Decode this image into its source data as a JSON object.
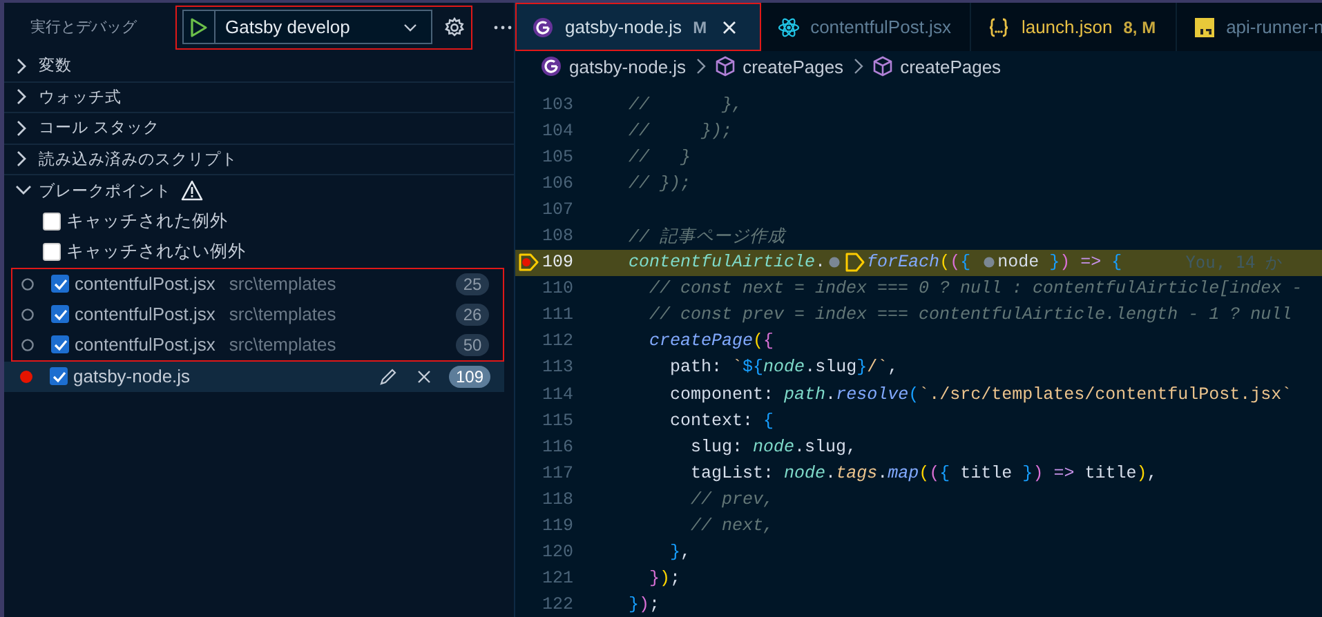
{
  "sidebar": {
    "title": "実行とデバッグ",
    "run_config": {
      "name": "Gatsby develop",
      "highlighted": true
    },
    "sections": [
      {
        "label": "変数",
        "expanded": false,
        "warning": false
      },
      {
        "label": "ウォッチ式",
        "expanded": false,
        "warning": false
      },
      {
        "label": "コール スタック",
        "expanded": false,
        "warning": false
      },
      {
        "label": "読み込み済みのスクリプト",
        "expanded": false,
        "warning": false
      },
      {
        "label": "ブレークポイント",
        "expanded": true,
        "warning": true
      }
    ],
    "exception_filters": [
      {
        "label": "キャッチされた例外",
        "checked": false
      },
      {
        "label": "キャッチされない例外",
        "checked": false
      }
    ],
    "breakpoints": [
      {
        "file": "contentfulPost.jsx",
        "path": "src\\templates",
        "line": "25",
        "checked": true,
        "verified": false,
        "selected": false,
        "highlighted": true
      },
      {
        "file": "contentfulPost.jsx",
        "path": "src\\templates",
        "line": "26",
        "checked": true,
        "verified": false,
        "selected": false,
        "highlighted": true
      },
      {
        "file": "contentfulPost.jsx",
        "path": "src\\templates",
        "line": "50",
        "checked": true,
        "verified": false,
        "selected": false,
        "highlighted": true
      },
      {
        "file": "gatsby-node.js",
        "line": "109",
        "checked": true,
        "verified": true,
        "selected": true,
        "highlighted": false
      }
    ]
  },
  "editor": {
    "tabs": [
      {
        "label": "gatsby-node.js",
        "kind": "gatsby",
        "badge": "M",
        "warning": false,
        "selected": true,
        "highlighted": true
      },
      {
        "label": "contentfulPost.jsx",
        "kind": "react",
        "warning": false,
        "selected": false,
        "highlighted": false
      },
      {
        "label": "launch.json",
        "kind": "json",
        "badge": "8, M",
        "warning": true,
        "selected": false,
        "highlighted": false
      },
      {
        "label": "api-runner-n",
        "kind": "js",
        "warning": false,
        "selected": false,
        "highlighted": false
      }
    ],
    "breadcrumbs": [
      {
        "label": "gatsby-node.js",
        "kind": "gatsby"
      },
      {
        "label": "createPages",
        "kind": "cube"
      },
      {
        "label": "createPages",
        "kind": "cube"
      }
    ],
    "lines": [
      {
        "number": "103",
        "tokens": [
          {
            "kind": "comment",
            "t": "//       },"
          }
        ]
      },
      {
        "number": "104",
        "tokens": [
          {
            "kind": "comment",
            "t": "//     });"
          }
        ]
      },
      {
        "number": "105",
        "tokens": [
          {
            "kind": "comment",
            "t": "//   }"
          }
        ]
      },
      {
        "number": "106",
        "tokens": [
          {
            "kind": "comment",
            "t": "// });"
          }
        ]
      },
      {
        "number": "107"
      },
      {
        "number": "108",
        "tokens": [
          {
            "kind": "comment",
            "t": "// 記事ページ作成"
          }
        ]
      },
      {
        "number": "109",
        "current": true,
        "breakpoint": true,
        "tokens": [
          {
            "kind": "var",
            "t": "contentfulAirticle"
          },
          {
            "kind": "plain",
            "t": "."
          },
          {
            "kind": "inline-bp"
          },
          {
            "kind": "inline-bp-current"
          },
          {
            "kind": "func",
            "t": "forEach"
          },
          {
            "kind": "gold",
            "t": "("
          },
          {
            "kind": "orchid",
            "t": "("
          },
          {
            "kind": "blue",
            "t": "{ "
          },
          {
            "kind": "inline-bp"
          },
          {
            "kind": "plain",
            "t": "node "
          },
          {
            "kind": "blue",
            "t": "}"
          },
          {
            "kind": "orchid",
            "t": ")"
          },
          {
            "kind": "keyword",
            "t": " => "
          },
          {
            "kind": "blue",
            "t": "{"
          },
          {
            "kind": "blame",
            "t": "You, 14 か"
          }
        ]
      },
      {
        "number": "110",
        "tokens": [
          {
            "kind": "comment",
            "t": "  // const next = index === 0 ? null : contentfulAirticle[index -"
          }
        ]
      },
      {
        "number": "111",
        "tokens": [
          {
            "kind": "comment",
            "t": "  // const prev = index === contentfulAirticle.length - 1 ? null"
          }
        ]
      },
      {
        "number": "112",
        "tokens": [
          {
            "kind": "func",
            "t": "  createPage"
          },
          {
            "kind": "gold",
            "t": "("
          },
          {
            "kind": "orchid",
            "t": "{"
          }
        ]
      },
      {
        "number": "113",
        "tokens": [
          {
            "kind": "plain",
            "t": "    path: "
          },
          {
            "kind": "string",
            "t": "`"
          },
          {
            "kind": "blue",
            "t": "${"
          },
          {
            "kind": "var",
            "t": "node"
          },
          {
            "kind": "plain",
            "t": ".slug"
          },
          {
            "kind": "blue",
            "t": "}"
          },
          {
            "kind": "string",
            "t": "/`"
          },
          {
            "kind": "plain",
            "t": ","
          }
        ]
      },
      {
        "number": "114",
        "tokens": [
          {
            "kind": "plain",
            "t": "    component: "
          },
          {
            "kind": "var",
            "t": "path"
          },
          {
            "kind": "plain",
            "t": "."
          },
          {
            "kind": "func",
            "t": "resolve"
          },
          {
            "kind": "blue",
            "t": "("
          },
          {
            "kind": "string",
            "t": "`./src/templates/contentfulPost.jsx`"
          }
        ]
      },
      {
        "number": "115",
        "tokens": [
          {
            "kind": "plain",
            "t": "    context: "
          },
          {
            "kind": "blue",
            "t": "{"
          }
        ]
      },
      {
        "number": "116",
        "tokens": [
          {
            "kind": "plain",
            "t": "      slug: "
          },
          {
            "kind": "var",
            "t": "node"
          },
          {
            "kind": "plain",
            "t": ".slug,"
          }
        ]
      },
      {
        "number": "117",
        "tokens": [
          {
            "kind": "plain",
            "t": "      tagList: "
          },
          {
            "kind": "var",
            "t": "node"
          },
          {
            "kind": "plain",
            "t": "."
          },
          {
            "kind": "prop",
            "t": "tags"
          },
          {
            "kind": "plain",
            "t": "."
          },
          {
            "kind": "func",
            "t": "map"
          },
          {
            "kind": "gold",
            "t": "("
          },
          {
            "kind": "orchid",
            "t": "("
          },
          {
            "kind": "blue",
            "t": "{"
          },
          {
            "kind": "plain",
            "t": " title "
          },
          {
            "kind": "blue",
            "t": "}"
          },
          {
            "kind": "orchid",
            "t": ")"
          },
          {
            "kind": "keyword",
            "t": " => "
          },
          {
            "kind": "plain",
            "t": "title"
          },
          {
            "kind": "gold",
            "t": ")"
          },
          {
            "kind": "plain",
            "t": ","
          }
        ]
      },
      {
        "number": "118",
        "tokens": [
          {
            "kind": "comment",
            "t": "      // prev,"
          }
        ]
      },
      {
        "number": "119",
        "tokens": [
          {
            "kind": "comment",
            "t": "      // next,"
          }
        ]
      },
      {
        "number": "120",
        "tokens": [
          {
            "kind": "blue",
            "t": "    }"
          },
          {
            "kind": "plain",
            "t": ","
          }
        ]
      },
      {
        "number": "121",
        "tokens": [
          {
            "kind": "orchid",
            "t": "  }"
          },
          {
            "kind": "gold",
            "t": ")"
          },
          {
            "kind": "plain",
            "t": ";"
          }
        ]
      },
      {
        "number": "122",
        "tokens": [
          {
            "kind": "blue",
            "t": "}"
          },
          {
            "kind": "orchid",
            "t": ")"
          },
          {
            "kind": "plain",
            "t": ";"
          }
        ]
      }
    ]
  }
}
